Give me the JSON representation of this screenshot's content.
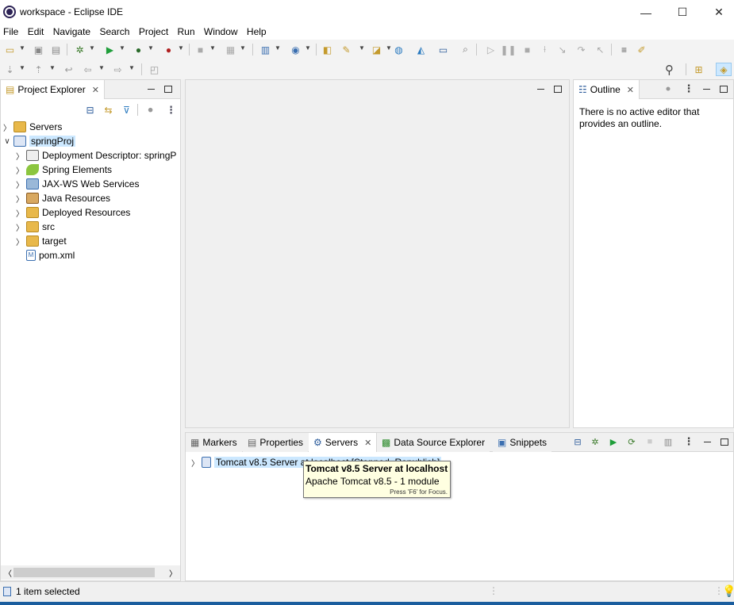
{
  "window": {
    "title": "workspace - Eclipse IDE",
    "minimize": "—",
    "maximize": "☐",
    "close": "✕"
  },
  "menu": [
    "File",
    "Edit",
    "Navigate",
    "Search",
    "Project",
    "Run",
    "Window",
    "Help"
  ],
  "project_explorer": {
    "tab_label": "Project Explorer",
    "items": [
      {
        "label": "Servers",
        "level": 0,
        "expanded": false,
        "icon": "folder-icon"
      },
      {
        "label": "springProj",
        "level": 0,
        "expanded": true,
        "icon": "maven-project-icon",
        "selected": true
      },
      {
        "label": "Deployment Descriptor: springP",
        "level": 1,
        "expanded": false,
        "icon": "deployment-descriptor-icon"
      },
      {
        "label": "Spring Elements",
        "level": 1,
        "expanded": false,
        "icon": "spring-leaf-icon"
      },
      {
        "label": "JAX-WS Web Services",
        "level": 1,
        "expanded": false,
        "icon": "web-services-icon"
      },
      {
        "label": "Java Resources",
        "level": 1,
        "expanded": false,
        "icon": "java-resources-icon"
      },
      {
        "label": "Deployed Resources",
        "level": 1,
        "expanded": false,
        "icon": "deployed-resources-icon"
      },
      {
        "label": "src",
        "level": 1,
        "expanded": false,
        "icon": "folder-icon"
      },
      {
        "label": "target",
        "level": 1,
        "expanded": false,
        "icon": "folder-icon"
      },
      {
        "label": "pom.xml",
        "level": 1,
        "expanded": null,
        "icon": "maven-file-icon"
      }
    ]
  },
  "outline": {
    "tab_label": "Outline",
    "message": "There is no active editor that provides an outline."
  },
  "bottom_tabs": [
    {
      "label": "Markers",
      "icon": "markers-icon"
    },
    {
      "label": "Properties",
      "icon": "properties-icon"
    },
    {
      "label": "Servers",
      "icon": "servers-icon",
      "active": true
    },
    {
      "label": "Data Source Explorer",
      "icon": "data-source-icon"
    },
    {
      "label": "Snippets",
      "icon": "snippets-icon"
    }
  ],
  "servers_view": {
    "row_label": "Tomcat v8.5 Server at localhost  [Stopped, Republish]",
    "tooltip": {
      "title": "Tomcat v8.5 Server at localhost",
      "detail": "Apache Tomcat v8.5 - 1 module",
      "hint": "Press 'F6' for Focus."
    }
  },
  "status": {
    "text": "1 item selected"
  },
  "colors": {
    "selection": "#cce8ff",
    "accent": "#1a5d9e",
    "tooltip_bg": "#ffffe1"
  }
}
